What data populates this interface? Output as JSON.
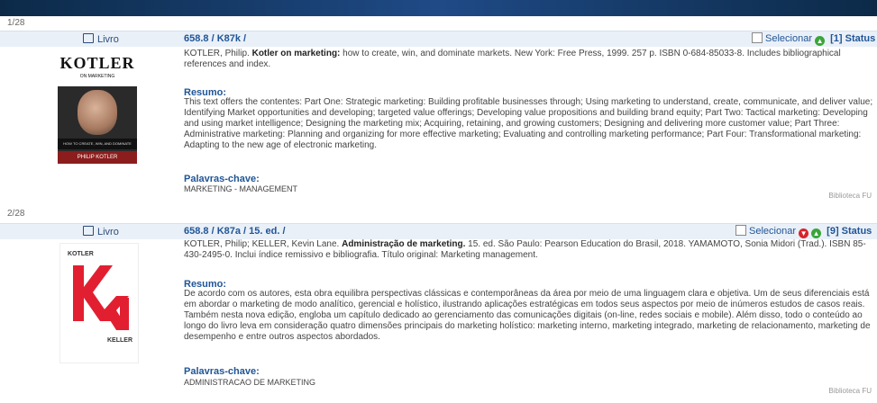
{
  "records": [
    {
      "counter": "1/28",
      "type_label": "Livro",
      "classification": "658.8 / K87k /",
      "select_label": "Selecionar",
      "status_label": "[1] Status",
      "author": "KOTLER, Philip.",
      "title": "Kotler on marketing:",
      "rest": "how to create, win, and dominate markets. New York: Free Press, 1999. 257 p. ISBN 0-684-85033-8. Includes bibliographical references and index.",
      "resumo_label": "Resumo:",
      "resumo": "This text offers the contentes: Part One: Strategic marketing: Building profitable businesses through; Using marketing to understand, create, communicate, and deliver value; Identifying Market opportunities and developing; targeted value offerings; Developing value propositions and building brand equity; Part Two: Tactical marketing: Developing and using market intelligence; Designing the marketing mix; Acquiring, retaining, and growing customers; Designing and delivering more customer value; Part Three: Administrative marketing: Planning and organizing for more effective marketing; Evaluating and controlling marketing performance; Part Four: Transformational marketing: Adapting to the new age of electronic marketing.",
      "kw_label": "Palavras-chave:",
      "keywords": "MARKETING - MANAGEMENT",
      "library": "Biblioteca FU",
      "cover": {
        "title": "KOTLER",
        "subtitle": "ON MARKETING",
        "band": "HOW TO CREATE, WIN, AND DOMINATE MARKETS",
        "author": "PHILIP KOTLER"
      }
    },
    {
      "counter": "2/28",
      "type_label": "Livro",
      "classification": "658.8 / K87a / 15. ed. /",
      "select_label": "Selecionar",
      "status_label": "[9] Status",
      "author": "KOTLER, Philip; KELLER, Kevin Lane.",
      "title": "Administração de marketing.",
      "rest": "15. ed. São Paulo: Pearson Education do Brasil, 2018. YAMAMOTO, Sonia Midori (Trad.). ISBN 85-430-2495-0. Inclui índice remissivo e bibliografia. Título original: Marketing management.",
      "resumo_label": "Resumo:",
      "resumo": "De acordo com os autores, esta obra equilibra perspectivas clássicas e contemporâneas da área por meio de uma linguagem clara e objetiva. Um de seus diferenciais está em abordar o marketing de modo analítico, gerencial e holístico, ilustrando aplicações estratégicas em todos seus aspectos por meio de inúmeros estudos de casos reais. Também nesta nova edição, engloba um capítulo dedicado ao gerenciamento das comunicações digitais (on-line, redes sociais e mobile). Além disso, todo o conteúdo ao longo do livro leva em consideração quatro dimensões principais do marketing holístico: marketing interno, marketing integrado, marketing de relacionamento, marketing de desempenho e entre outros aspectos abordados.",
      "kw_label": "Palavras-chave:",
      "keywords": "ADMINISTRACAO DE MARKETING",
      "library": "Biblioteca FU",
      "cover": {
        "top": "KOTLER",
        "bottom": "KELLER"
      }
    }
  ],
  "colors": {
    "accent": "#1f5596",
    "header_bg": "#eaf0f8",
    "available": "#3aa53a",
    "unavailable": "#d8232a"
  },
  "icons": {
    "type": "book-icon",
    "available": "available-status-icon",
    "unavailable": "unavailable-status-icon"
  }
}
